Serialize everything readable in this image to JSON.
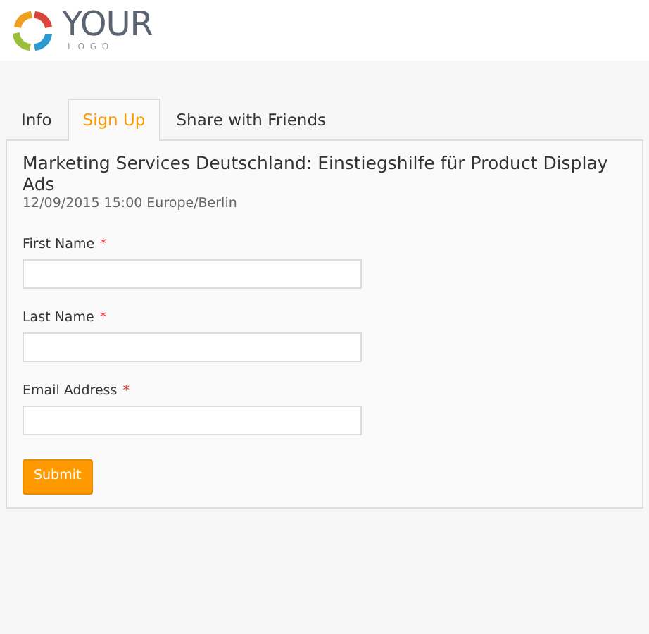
{
  "logo": {
    "word": "YOUR",
    "subword": "L O G O"
  },
  "tabs": [
    {
      "label": "Info",
      "selected": false
    },
    {
      "label": "Sign Up",
      "selected": true
    },
    {
      "label": "Share with Friends",
      "selected": false
    }
  ],
  "event": {
    "title": "Marketing Services Deutschland: Einstiegshilfe für Product Display Ads",
    "date": "12/09/2015 15:00 Europe/Berlin"
  },
  "form": {
    "fields": [
      {
        "label": "First Name",
        "required_mark": "*"
      },
      {
        "label": "Last Name",
        "required_mark": "*"
      },
      {
        "label": "Email Address",
        "required_mark": "*"
      }
    ],
    "submit": "Submit"
  }
}
